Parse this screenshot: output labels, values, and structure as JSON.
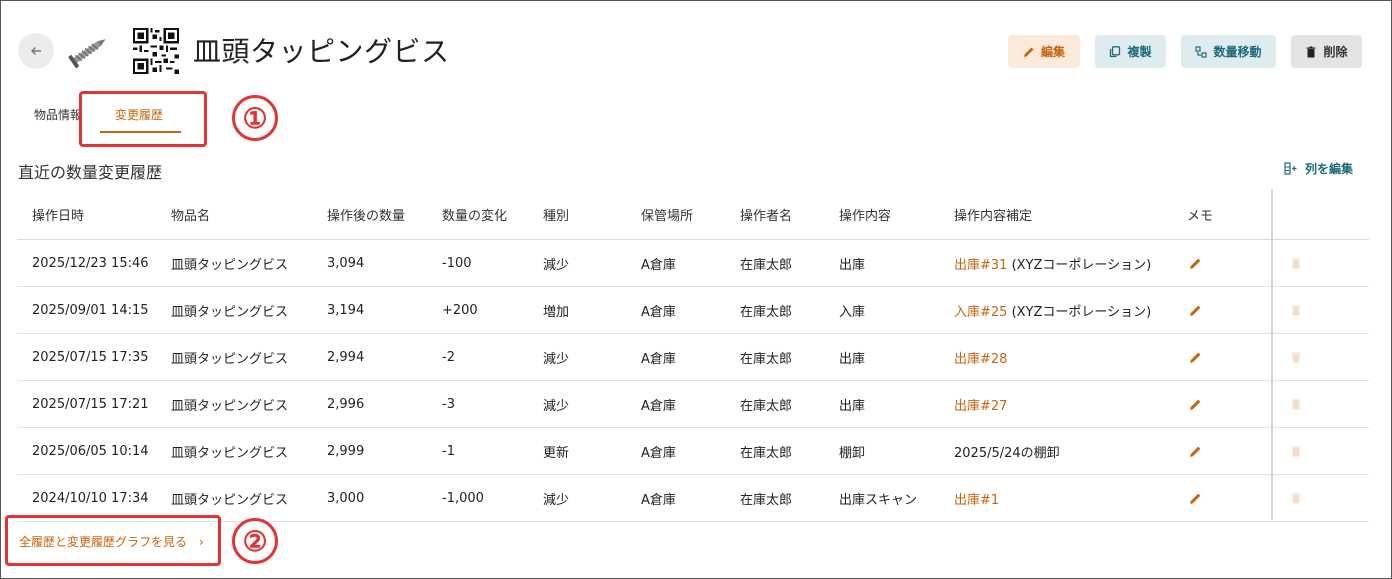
{
  "header": {
    "title": "皿頭タッピングビス",
    "back_icon": "arrow-left-icon",
    "image_icon": "screw-image",
    "qr_icon": "qr-code-icon"
  },
  "actions": {
    "edit": "編集",
    "copy": "複製",
    "move": "数量移動",
    "delete": "削除"
  },
  "tabs": [
    {
      "label": "物品情報"
    },
    {
      "label": "変更履歴",
      "active": true
    }
  ],
  "annotations": {
    "one": "①",
    "two": "②"
  },
  "section": {
    "title": "直近の数量変更履歴",
    "column_edit": "列を編集"
  },
  "table": {
    "headers": [
      "操作日時",
      "物品名",
      "操作後の数量",
      "数量の変化",
      "種別",
      "保管場所",
      "操作者名",
      "操作内容",
      "操作内容補定",
      "メモ"
    ],
    "rows": [
      {
        "date": "2025/12/23 15:46",
        "item": "皿頭タッピングビス",
        "after": "3,094",
        "change": "-100",
        "kind": "減少",
        "place": "A倉庫",
        "user": "在庫太郎",
        "op": "出庫",
        "detail_link": "出庫#31",
        "detail_text": " (XYZコーポレーション)"
      },
      {
        "date": "2025/09/01 14:15",
        "item": "皿頭タッピングビス",
        "after": "3,194",
        "change": "+200",
        "kind": "増加",
        "place": "A倉庫",
        "user": "在庫太郎",
        "op": "入庫",
        "detail_link": "入庫#25",
        "detail_text": " (XYZコーポレーション)"
      },
      {
        "date": "2025/07/15 17:35",
        "item": "皿頭タッピングビス",
        "after": "2,994",
        "change": "-2",
        "kind": "減少",
        "place": "A倉庫",
        "user": "在庫太郎",
        "op": "出庫",
        "detail_link": "出庫#28",
        "detail_text": ""
      },
      {
        "date": "2025/07/15 17:21",
        "item": "皿頭タッピングビス",
        "after": "2,996",
        "change": "-3",
        "kind": "減少",
        "place": "A倉庫",
        "user": "在庫太郎",
        "op": "出庫",
        "detail_link": "出庫#27",
        "detail_text": ""
      },
      {
        "date": "2025/06/05 10:14",
        "item": "皿頭タッピングビス",
        "after": "2,999",
        "change": "-1",
        "kind": "更新",
        "place": "A倉庫",
        "user": "在庫太郎",
        "op": "棚卸",
        "detail_link": "",
        "detail_text": "2025/5/24の棚卸"
      },
      {
        "date": "2024/10/10 17:34",
        "item": "皿頭タッピングビス",
        "after": "3,000",
        "change": "-1,000",
        "kind": "減少",
        "place": "A倉庫",
        "user": "在庫太郎",
        "op": "出庫スキャン",
        "detail_link": "出庫#1",
        "detail_text": ""
      }
    ]
  },
  "footer": {
    "link": "全履歴と変更履歴グラフを見る",
    "chevron": "›"
  },
  "colors": {
    "accent": "#c8640c",
    "teal": "#1f6b7a",
    "annotation_red": "#e23434"
  }
}
